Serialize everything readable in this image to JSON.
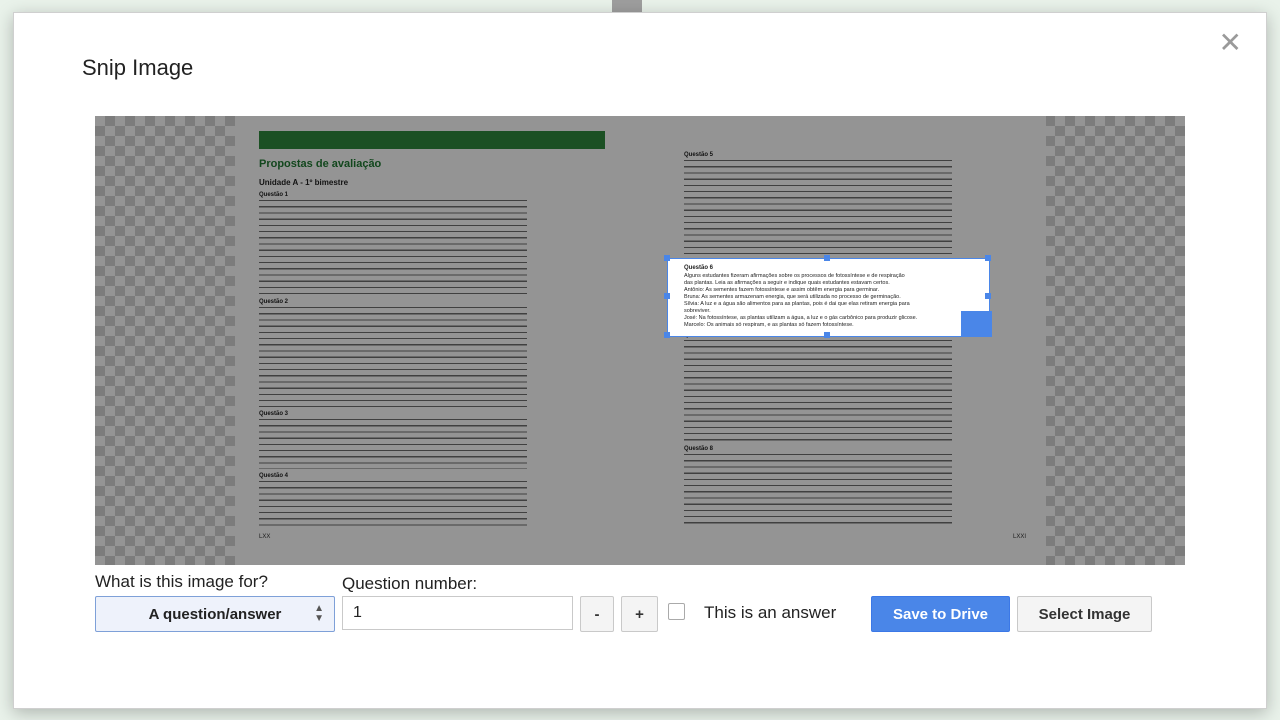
{
  "dialog": {
    "title": "Snip Image",
    "close_icon": "close-icon"
  },
  "preview": {
    "page_title": "Propostas de avaliação",
    "unit": "Unidade A - 1º bimestre",
    "left_questions": [
      "Questão 1",
      "Questão 2",
      "Questão 3",
      "Questão 4"
    ],
    "right_questions": [
      "Questão 5",
      "Questão 7",
      "Questão 8"
    ],
    "page_number_left": "LXX",
    "page_number_right": "LXXI",
    "selection": {
      "heading": "Questão 6",
      "lines": [
        "Alguns estudantes fizeram afirmações sobre os processos de fotossíntese e de respiração",
        "das plantas. Leia as afirmações a seguir e indique quais estudantes estavam certos.",
        "Antônio: As sementes fazem fotossíntese e assim obtêm energia para germinar.",
        "Bruna: As sementes armazenam energia, que será utilizada no processo de germinação.",
        "Sílvia: A luz e a água são alimentos para as plantas, pois é dai que elas retiram energia para",
        "sobreviver.",
        "José: Na fotossíntese, as plantas utilizam a água, a luz e o gás carbônico para produzir glicose.",
        "Marcelo: Os animais só respiram, e as plantas só fazem fotossíntese."
      ]
    }
  },
  "form": {
    "purpose_label": "What is this image for?",
    "purpose_value": "A question/answer",
    "question_number_label": "Question number:",
    "question_number_value": "1",
    "decrement_label": "-",
    "increment_label": "+",
    "answer_checkbox_label": "This is an answer",
    "answer_checked": false,
    "save_label": "Save to Drive",
    "select_image_label": "Select Image"
  },
  "colors": {
    "accent": "#4a86e8",
    "heading_green": "#1f7a33"
  }
}
